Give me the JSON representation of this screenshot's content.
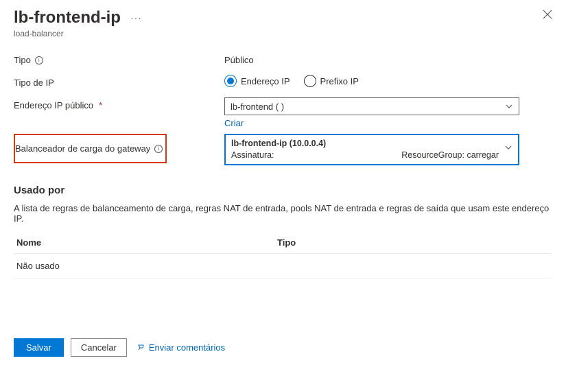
{
  "header": {
    "title": "lb-frontend-ip",
    "subtitle": "load-balancer"
  },
  "fields": {
    "tipo_label": "Tipo",
    "tipo_value": "Público",
    "tipo_ip_label": "Tipo de IP",
    "radio_endereco": "Endereço IP",
    "radio_prefixo": "Prefixo IP",
    "endereco_publico_label": "Endereço IP público",
    "endereco_publico_value": "lb-frontend (                           )",
    "criar_link": "Criar",
    "gateway_label": "Balanceador de carga do gateway",
    "gateway_title": "lb-frontend-ip (10.0.0.4)",
    "gateway_sub_left": "Assinatura:",
    "gateway_sub_right": "ResourceGroup: carregar"
  },
  "used_by": {
    "title": "Usado por",
    "desc": "A lista de regras de balanceamento de carga, regras NAT de entrada, pools NAT de entrada e regras de saída que usam este endereço IP.",
    "col_nome": "Nome",
    "col_tipo": "Tipo",
    "row_value": "Não usado"
  },
  "footer": {
    "save": "Salvar",
    "cancel": "Cancelar",
    "feedback": "Enviar comentários"
  }
}
